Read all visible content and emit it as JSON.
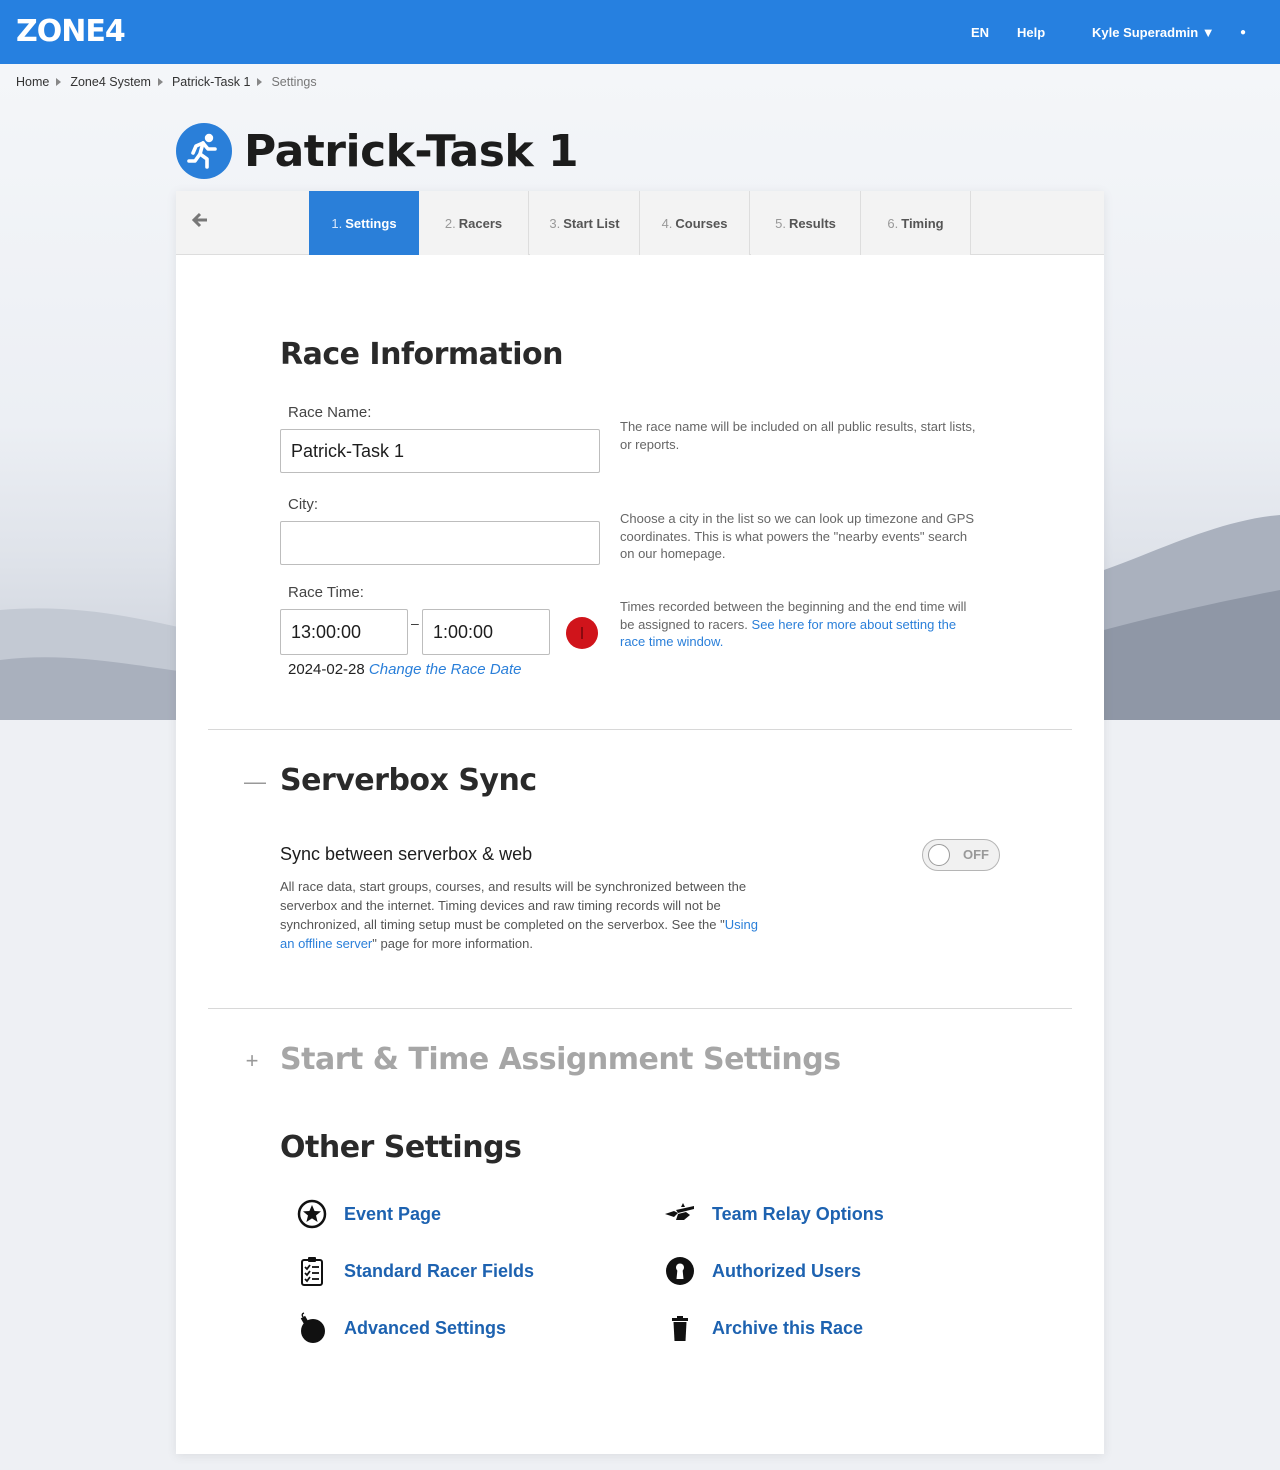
{
  "header": {
    "logo": "ZONE4",
    "lang": "EN",
    "help": "Help",
    "user": "Kyle Superadmin ▼",
    "dot": "●"
  },
  "breadcrumb": [
    "Home",
    "Zone4 System",
    "Patrick-Task 1",
    "Settings"
  ],
  "page_title": "Patrick-Task 1",
  "tabs": [
    {
      "num": "1.",
      "label": "Settings"
    },
    {
      "num": "2.",
      "label": "Racers"
    },
    {
      "num": "3.",
      "label": "Start List"
    },
    {
      "num": "4.",
      "label": "Courses"
    },
    {
      "num": "5.",
      "label": "Results"
    },
    {
      "num": "6.",
      "label": "Timing"
    }
  ],
  "race_info": {
    "heading": "Race Information",
    "name_label": "Race Name:",
    "name_value": "Patrick-Task 1",
    "name_help": "The race name will be included on all public results, start lists, or reports.",
    "city_label": "City:",
    "city_value": "",
    "city_help": "Choose a city in the list so we can look up timezone and GPS coordinates. This is what powers the \"nearby events\" search on our homepage.",
    "time_label": "Race Time:",
    "start_time": "13:00:00",
    "time_separator": "–",
    "end_time": "1:00:00",
    "time_help_prefix": "Times recorded between the beginning and the end time will be assigned to racers.",
    "time_help_link": "See here for more about setting the race time window.",
    "date": "2024-02-28",
    "change_date": "Change the Race Date"
  },
  "serverbox": {
    "heading": "Serverbox Sync",
    "collapse_symbol": "—",
    "sync_title": "Sync between serverbox & web",
    "sync_desc_1": "All race data, start groups, courses, and results will be synchronized between the serverbox and the internet. Timing devices and raw timing records will not be synchronized, all timing setup must be completed on the serverbox. See the \"",
    "sync_desc_link": "Using an offline server",
    "sync_desc_2": "\" page for more information.",
    "toggle_state": "OFF"
  },
  "start_time_settings": {
    "heading": "Start & Time Assignment Settings",
    "expand_symbol": "+"
  },
  "other_settings": {
    "heading": "Other Settings",
    "items": [
      {
        "label": "Event Page",
        "icon": "star-circle-icon"
      },
      {
        "label": "Team Relay Options",
        "icon": "relay-baton-icon"
      },
      {
        "label": "Standard Racer Fields",
        "icon": "clipboard-checklist-icon"
      },
      {
        "label": "Authorized Users",
        "icon": "keyhole-icon"
      },
      {
        "label": "Advanced Settings",
        "icon": "bomb-icon"
      },
      {
        "label": "Archive this Race",
        "icon": "trash-icon"
      }
    ]
  },
  "colors": {
    "brand_blue": "#2680e0",
    "link_blue": "#1d62b0",
    "alert_red": "#d0141b"
  }
}
